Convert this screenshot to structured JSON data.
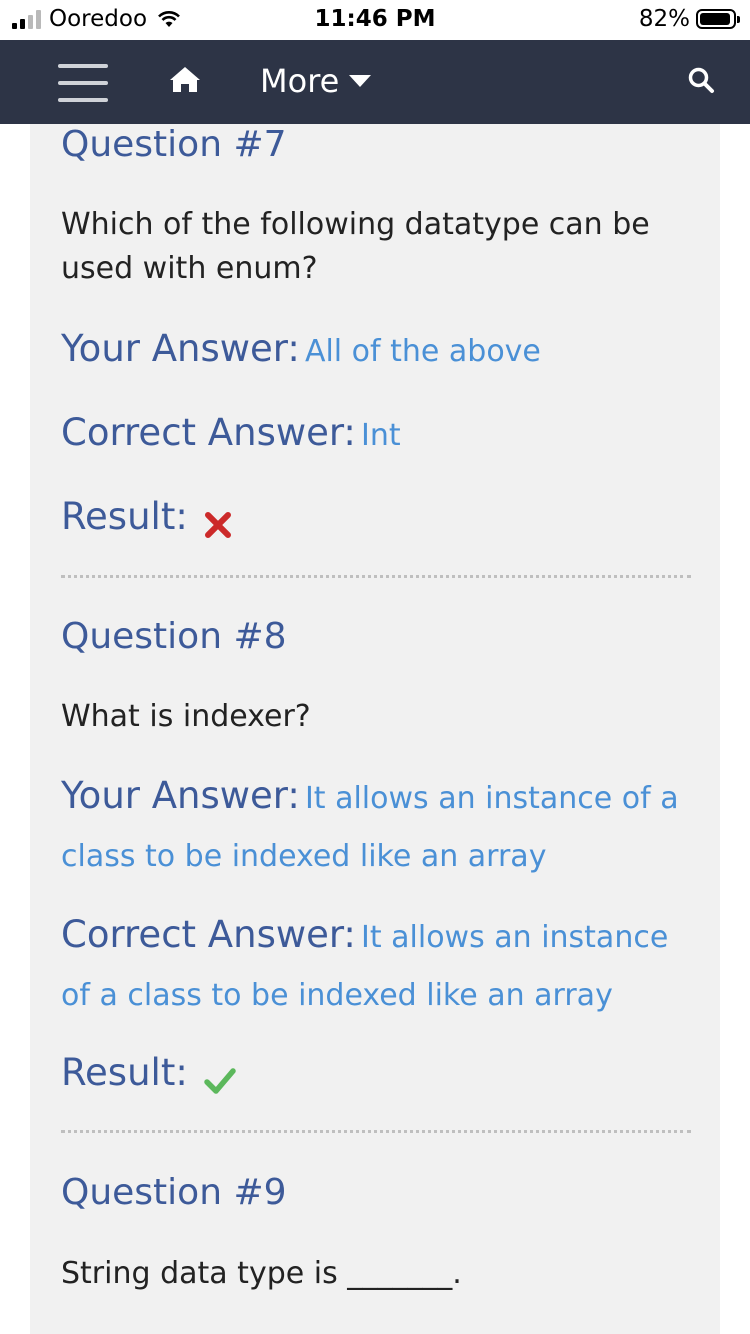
{
  "status_bar": {
    "carrier": "Ooredoo",
    "time": "11:46 PM",
    "battery": "82%"
  },
  "nav": {
    "more_label": "More"
  },
  "questions": [
    {
      "title": "Question #7",
      "text": "Which of the following datatype can be used with enum?",
      "your_answer_label": "Your Answer:",
      "your_answer": "All of the above",
      "correct_answer_label": "Correct Answer:",
      "correct_answer": "Int",
      "result_label": "Result:",
      "result": "incorrect"
    },
    {
      "title": "Question #8",
      "text": "What is indexer?",
      "your_answer_label": "Your Answer:",
      "your_answer": "It allows an instance of a class to be indexed like an array",
      "correct_answer_label": "Correct Answer:",
      "correct_answer": "It allows an instance of a class to be indexed like an array",
      "result_label": "Result:",
      "result": "correct"
    },
    {
      "title": "Question #9",
      "text": "String data type is _______."
    }
  ],
  "colors": {
    "nav_bg": "#2d3446",
    "label": "#3d5a99",
    "answer": "#4a90d6",
    "incorrect": "#cc2a2a",
    "correct": "#5cb85c"
  }
}
